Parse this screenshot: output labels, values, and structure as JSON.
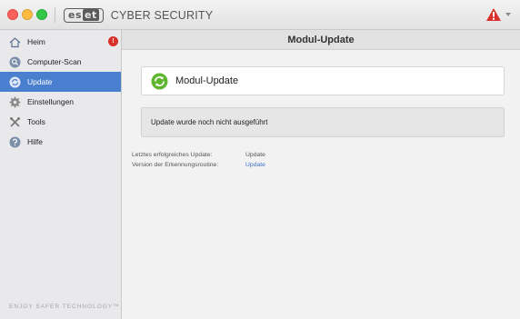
{
  "titlebar": {
    "logo_mark_a": "es",
    "logo_mark_b": "et",
    "product_name": "CYBER SECURITY"
  },
  "sidebar": {
    "items": [
      {
        "label": "Heim",
        "icon": "home-icon",
        "badge": "!"
      },
      {
        "label": "Computer-Scan",
        "icon": "scan-icon"
      },
      {
        "label": "Update",
        "icon": "update-icon",
        "active": true
      },
      {
        "label": "Einstellungen",
        "icon": "gear-icon"
      },
      {
        "label": "Tools",
        "icon": "tools-icon"
      },
      {
        "label": "Hilfe",
        "icon": "help-icon"
      }
    ],
    "tagline": "ENJOY SAFER TECHNOLOGY™"
  },
  "main": {
    "header_title": "Modul-Update",
    "module_title": "Modul-Update",
    "status_text": "Update wurde noch nicht ausgeführt",
    "info": [
      {
        "label": "Letztes erfolgreiches Update:",
        "value": "Update"
      },
      {
        "label": "Version der Erkennungsroutine:",
        "value": "Update"
      }
    ]
  },
  "colors": {
    "accent": "#4a7fd0",
    "badge": "#d9302c",
    "link": "#3f74c9",
    "warning": "#d9302c",
    "update_green": "#5fb72f"
  }
}
